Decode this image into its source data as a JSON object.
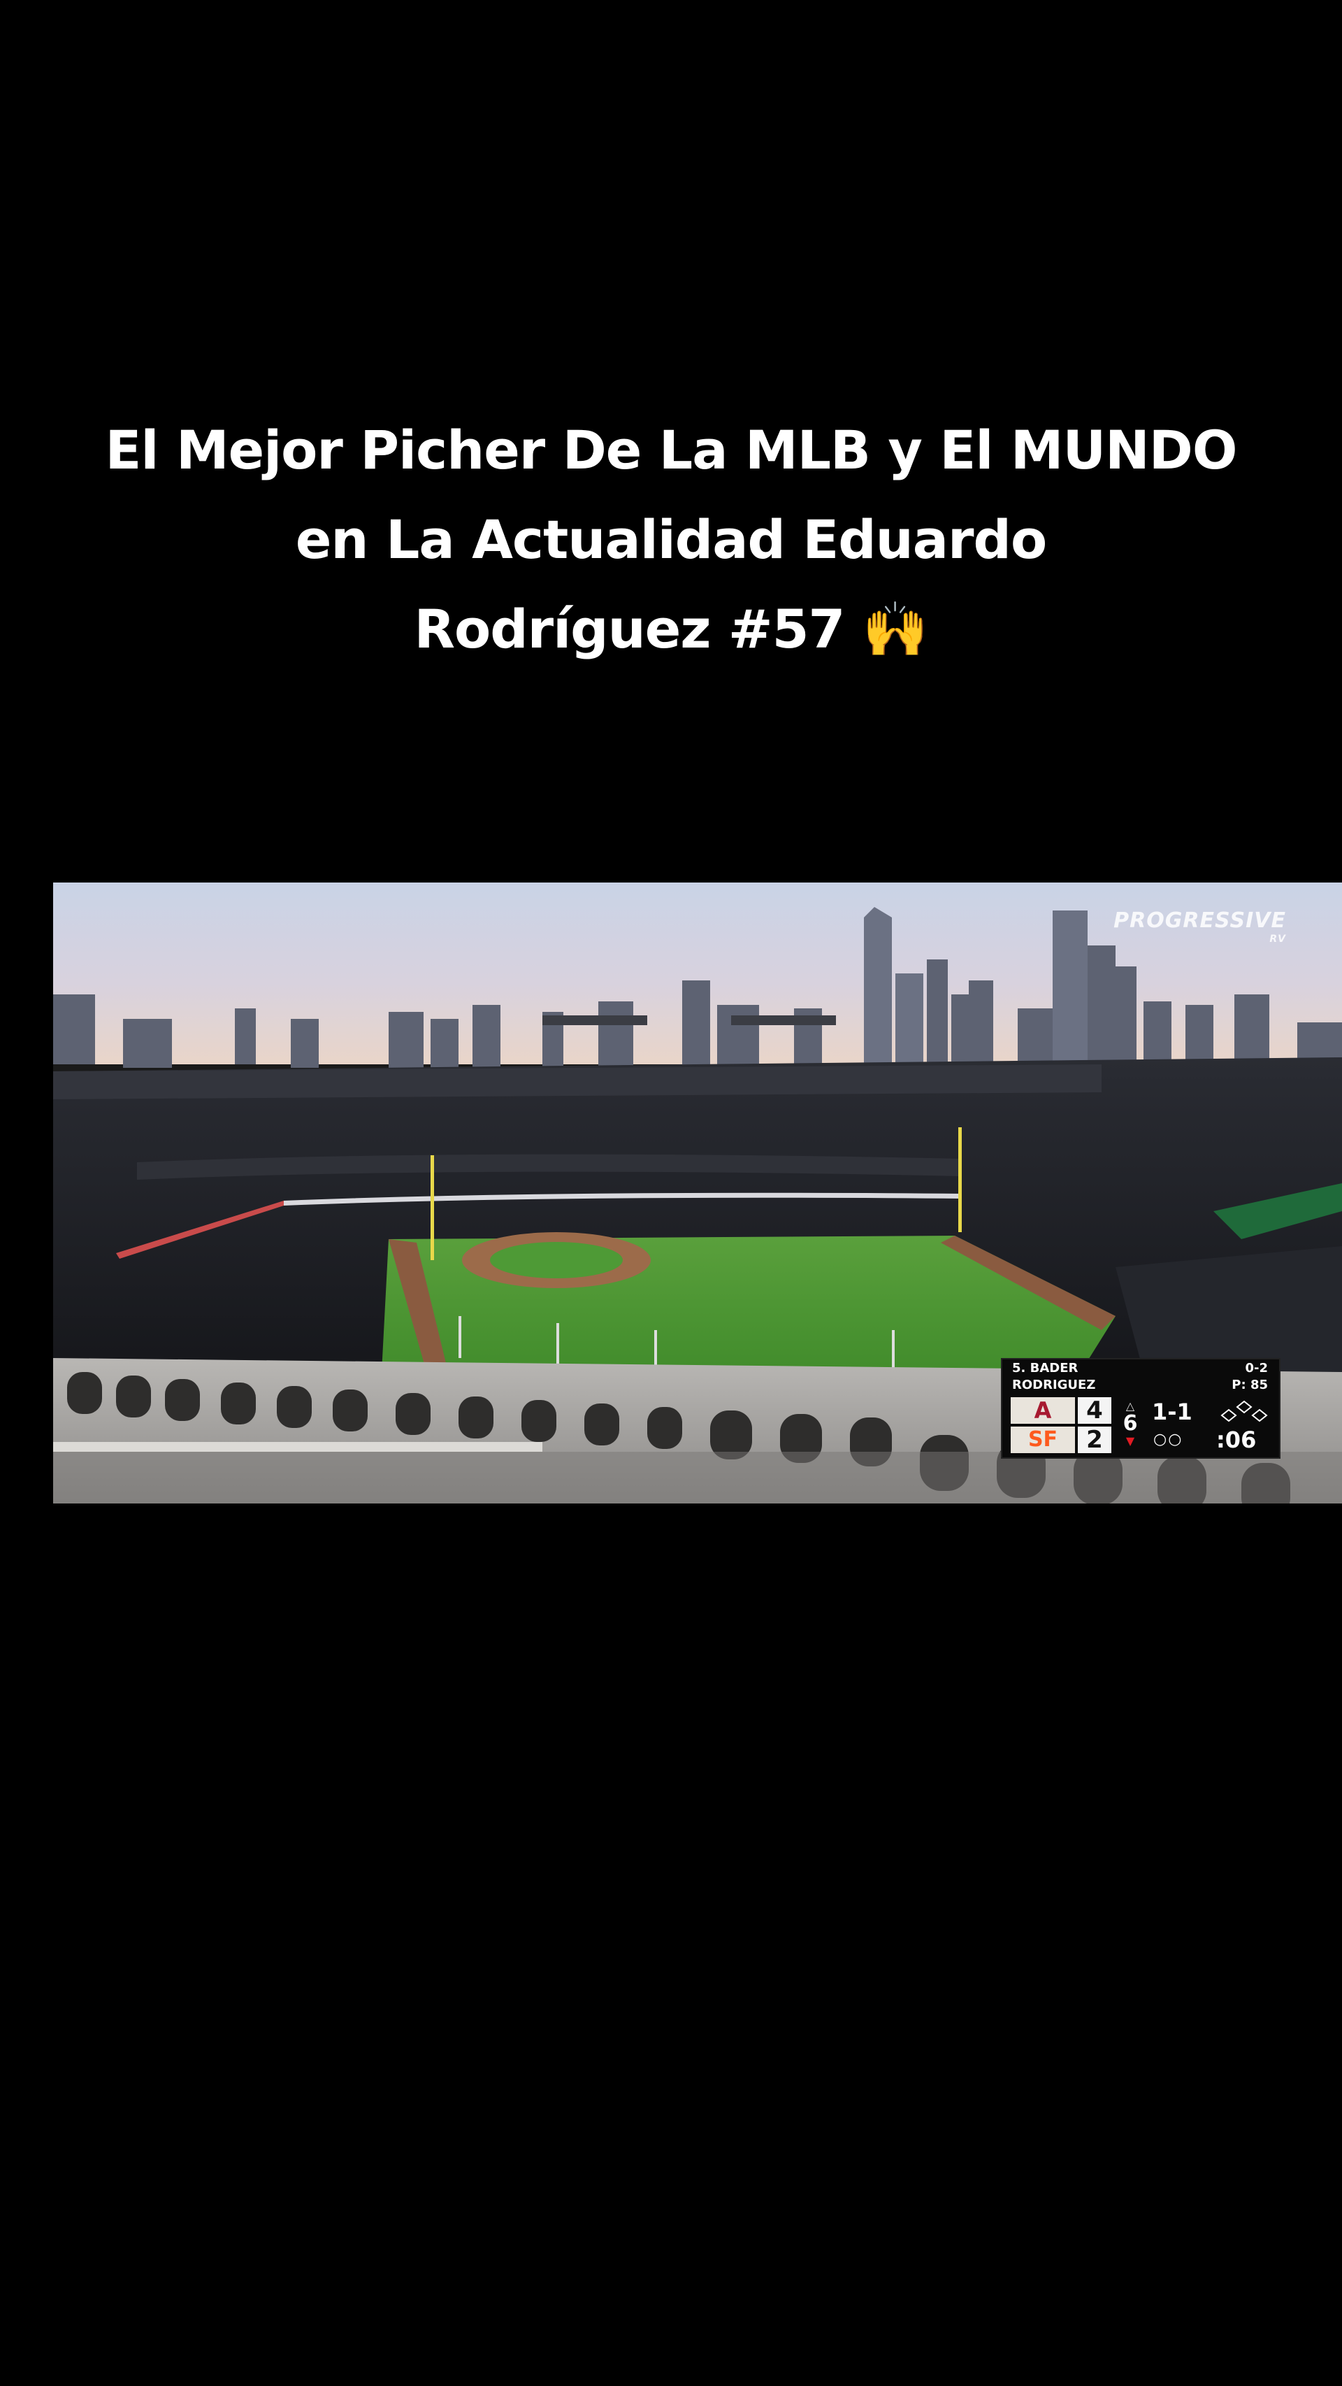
{
  "caption": {
    "line1": "El Mejor Picher De La MLB y El MUNDO",
    "line2": "en La Actualidad Eduardo",
    "line3": "Rodríguez #57 🙌"
  },
  "video": {
    "watermark": "PROGRESSIVE",
    "watermark_sub": "RV",
    "scorebug": {
      "batter": "5. BADER",
      "batter_stat": "0-2",
      "pitcher": "RODRIGUEZ",
      "pitch_count": "P: 85",
      "away_logo": "A",
      "away_score": "4",
      "home_logo": "SF",
      "home_score": "2",
      "inning": "6",
      "inning_up": "△",
      "inning_down": "▼",
      "count": "1-1",
      "outs": "○○",
      "clock": ":06"
    }
  }
}
